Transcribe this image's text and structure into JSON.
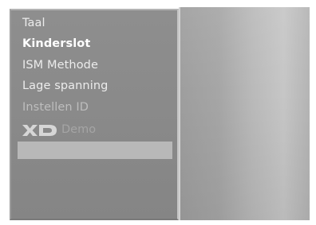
{
  "menu": {
    "items": [
      {
        "label": "Taal"
      },
      {
        "label": "Kinderslot"
      },
      {
        "label": "ISM Methode"
      },
      {
        "label": "Lage spanning"
      },
      {
        "label": "Instellen ID"
      }
    ],
    "xd_item": {
      "logo_text": "XD",
      "label": "Demo",
      "icon": "xd-logo-icon"
    },
    "selected_index": 6
  },
  "colors": {
    "panel": "#8a8a8a",
    "highlight": "#b8b8b8",
    "text": "#f4f4f4"
  }
}
